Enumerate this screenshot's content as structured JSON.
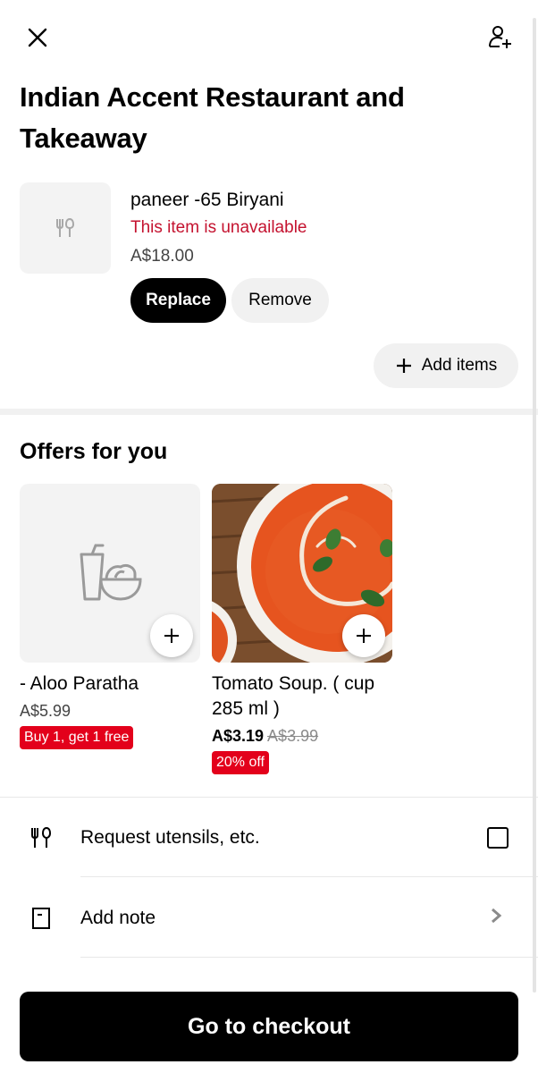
{
  "header": {
    "close_icon": "close-icon",
    "add_person_icon": "add-person-icon"
  },
  "restaurant": {
    "title": "Indian Accent Restaurant and Takeaway"
  },
  "cart_item": {
    "thumb_icon": "utensils-icon",
    "name": "paneer -65 Biryani",
    "status": "This item is unavailable",
    "price": "A$18.00",
    "replace_label": "Replace",
    "remove_label": "Remove"
  },
  "add_items": {
    "label": "Add items"
  },
  "offers": {
    "title": "Offers for you",
    "items": [
      {
        "name": "- Aloo Paratha",
        "price": "A$5.99",
        "old_price": "",
        "badge": "Buy 1, get 1 free",
        "image": "food-placeholder-icon"
      },
      {
        "name": "Tomato Soup. ( cup 285 ml )",
        "price": "A$3.19",
        "old_price": "A$3.99",
        "badge": "20% off",
        "image": "tomato-soup-photo"
      }
    ]
  },
  "options": {
    "utensils_label": "Request utensils, etc.",
    "utensils_checked": false,
    "note_label": "Add note"
  },
  "checkout": {
    "label": "Go to checkout"
  },
  "colors": {
    "unavailable": "#c4122f",
    "badge": "#e3001b",
    "primary": "#000000",
    "secondary_bg": "#f1f1f1"
  }
}
